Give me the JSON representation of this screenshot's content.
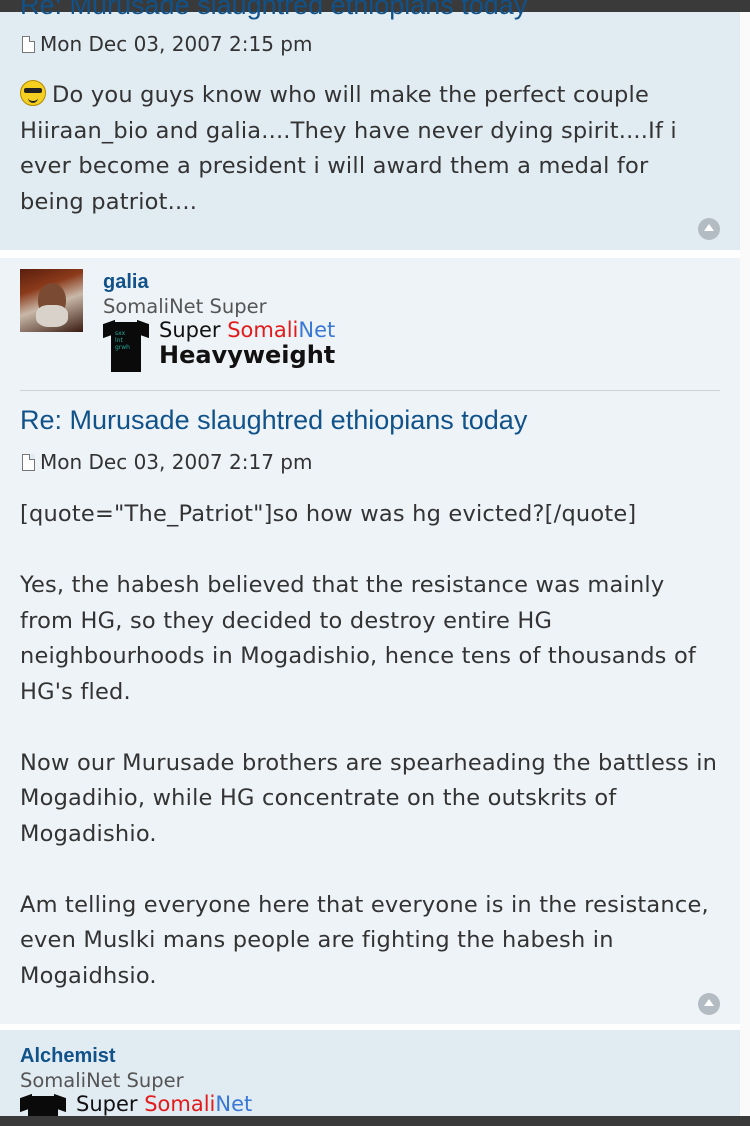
{
  "post1": {
    "title": "Re: Murusade slaughtred ethiopians today",
    "date": "Mon Dec 03, 2007 2:15 pm",
    "smiley_icon": "cool-smiley-icon",
    "lines": [
      "Do you guys know who will make the perfect couple",
      "Hiiraan_bio and galia....They have never dying spirit....If i",
      "ever become a president i will award them a medal for",
      "being patriot...."
    ]
  },
  "post2": {
    "author": "galia",
    "rank": "SomaliNet Super",
    "badge": {
      "line1_a": "Super ",
      "line1_b": "Somali",
      "line1_c": "Net",
      "line2": "Heavyweight"
    },
    "title": "Re: Murusade slaughtred ethiopians today",
    "date": "Mon Dec 03, 2007 2:17 pm",
    "lines": [
      "[quote=\"The_Patriot\"]so how was hg evicted?[/quote]",
      "",
      "Yes, the habesh believed that the resistance was mainly",
      "from HG, so they decided to destroy entire HG",
      "neighbourhoods in Mogadishio, hence tens of thousands of",
      "HG's fled.",
      "",
      "Now our Murusade brothers are spearheading the battless in",
      "Mogadihio, while HG concentrate on the outskrits of",
      "Mogadishio.",
      "",
      "Am telling everyone here that everyone is in the resistance,",
      "even Muslki mans people are fighting the habesh in",
      "Mogaidhsio."
    ]
  },
  "post3": {
    "author": "Alchemist",
    "rank": "SomaliNet Super",
    "badge": {
      "line1_a": "Super ",
      "line1_b": "Somali",
      "line1_c": "Net"
    }
  },
  "colors": {
    "title": "#105289",
    "post_bg_a": "#e1ebf2",
    "post_bg_b": "#eef3f7"
  }
}
